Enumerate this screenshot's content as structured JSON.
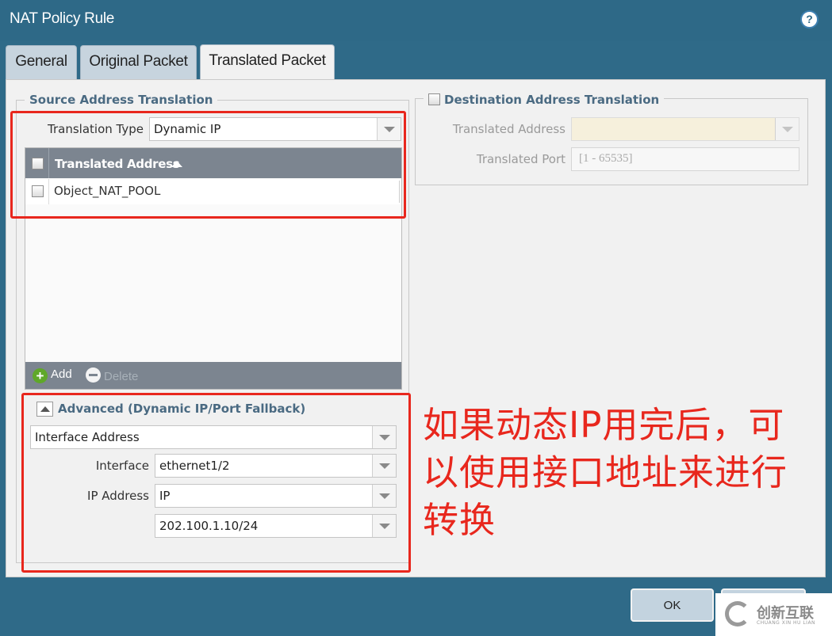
{
  "window": {
    "title": "NAT Policy Rule"
  },
  "tabs": [
    {
      "label": "General"
    },
    {
      "label": "Original Packet"
    },
    {
      "label": "Translated Packet"
    }
  ],
  "source_translation": {
    "legend": "Source Address Translation",
    "translation_type_label": "Translation Type",
    "translation_type_value": "Dynamic IP",
    "grid": {
      "column_header": "Translated Address",
      "rows": [
        {
          "value": "Object_NAT_POOL"
        }
      ],
      "add_label": "Add",
      "delete_label": "Delete"
    },
    "advanced": {
      "title": "Advanced (Dynamic IP/Port Fallback)",
      "fallback_type_value": "Interface Address",
      "interface_label": "Interface",
      "interface_value": "ethernet1/2",
      "ip_address_label": "IP Address",
      "ip_address_type_value": "IP",
      "ip_address_value": "202.100.1.10/24"
    }
  },
  "destination_translation": {
    "legend": "Destination Address Translation",
    "translated_address_label": "Translated Address",
    "translated_address_value": "",
    "translated_port_label": "Translated Port",
    "translated_port_placeholder": "[1 - 65535]"
  },
  "annotation": {
    "text": "如果动态IP用完后，可以使用接口地址来进行转换",
    "color": "#e8271d"
  },
  "buttons": {
    "ok_label": "OK",
    "cancel_label": ""
  },
  "watermark": {
    "text": "创新互联",
    "subtext": "CHUANG XIN HU LIAN"
  },
  "colors": {
    "title_bar": "#2e6987",
    "grid_header": "#7c8590",
    "accent_text": "#4a6a82",
    "annotation_red": "#e8271d"
  }
}
